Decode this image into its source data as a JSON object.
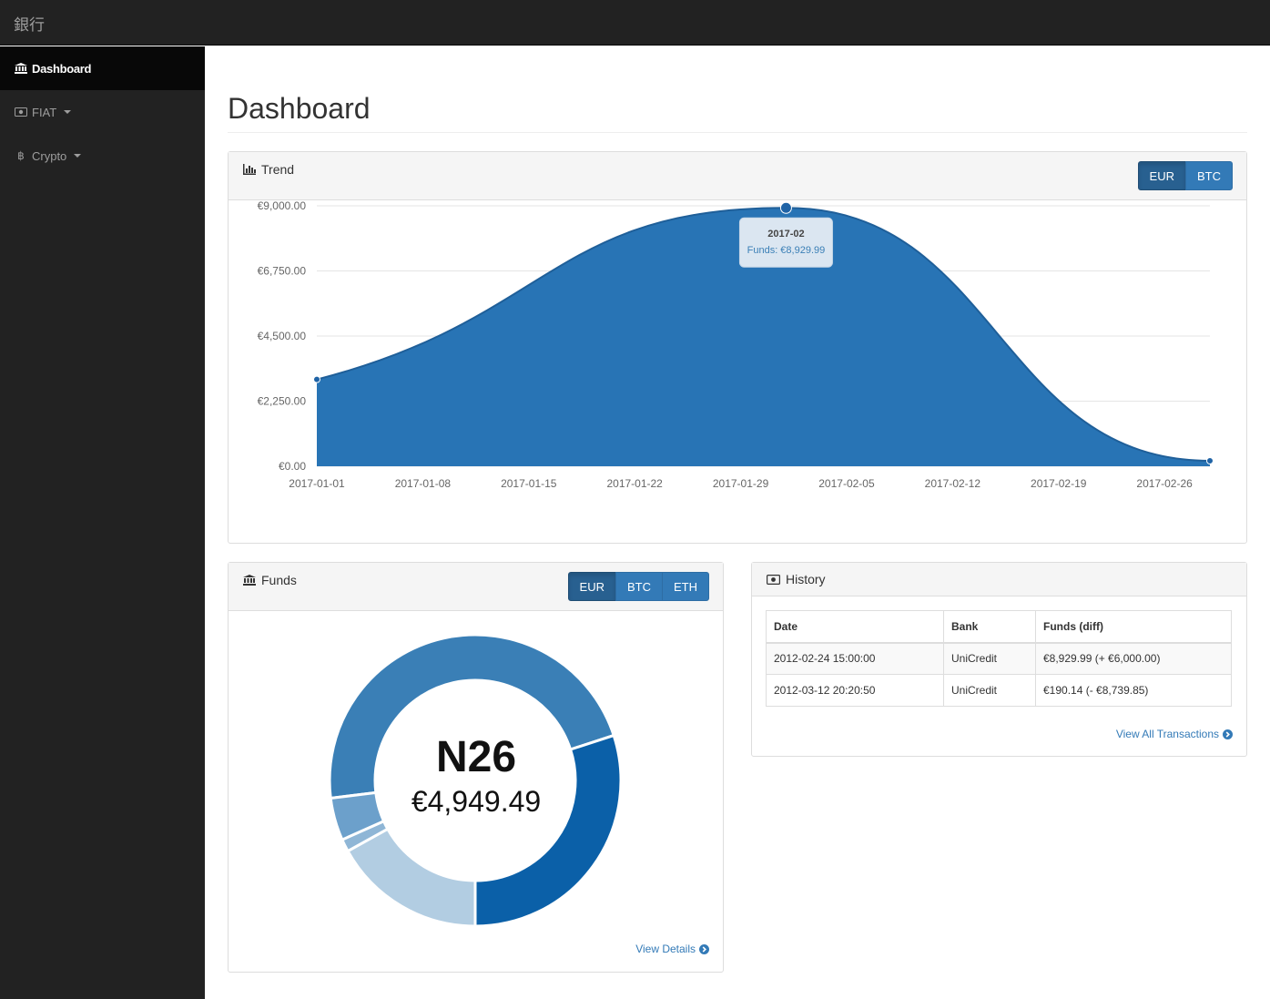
{
  "app": {
    "brand": "銀行"
  },
  "sidebar": {
    "items": [
      {
        "label": "Dashboard",
        "icon": "bank-icon",
        "active": true
      },
      {
        "label": "FIAT",
        "icon": "money-icon",
        "dropdown": true
      },
      {
        "label": "Crypto",
        "icon": "bitcoin-icon",
        "dropdown": true
      }
    ]
  },
  "page": {
    "title": "Dashboard"
  },
  "trend": {
    "title": "Trend",
    "currencies": [
      "EUR",
      "BTC"
    ],
    "active_currency": "EUR",
    "tooltip": {
      "title": "2017-02",
      "label": "Funds: €8,929.99"
    }
  },
  "chart_data": {
    "type": "area",
    "x": [
      "2017-01-01",
      "2017-02-01",
      "2017-03-01"
    ],
    "series": [
      {
        "values": [
          3000,
          8929.99,
          190.14
        ]
      }
    ],
    "ylim": [
      0,
      9000
    ],
    "y_ticks": [
      "€0.00",
      "€2,250.00",
      "€4,500.00",
      "€6,750.00",
      "€9,000.00"
    ],
    "y_tick_values": [
      0,
      2250,
      4500,
      6750,
      9000
    ],
    "x_ticks": [
      "2017-01-01",
      "2017-01-08",
      "2017-01-15",
      "2017-01-22",
      "2017-01-29",
      "2017-02-05",
      "2017-02-12",
      "2017-02-19",
      "2017-02-26"
    ],
    "grid": true,
    "color": "#2874b5"
  },
  "funds": {
    "title": "Funds",
    "currencies": [
      "EUR",
      "BTC",
      "ETH"
    ],
    "active_currency": "EUR",
    "center_title": "N26",
    "center_value": "€4,949.49",
    "view_details": "View Details",
    "donut_colors": [
      "#3a7fb6",
      "#0b60a8",
      "#b2cde2",
      "#8fb6d6",
      "#6ca0cb"
    ]
  },
  "history": {
    "title": "History",
    "columns": [
      "Date",
      "Bank",
      "Funds (diff)"
    ],
    "rows": [
      [
        "2012-02-24 15:00:00",
        "UniCredit",
        "€8,929.99 (+ €6,000.00)"
      ],
      [
        "2012-03-12 20:20:50",
        "UniCredit",
        "€190.14 (- €8,739.85)"
      ]
    ],
    "view_all": "View All Transactions"
  }
}
